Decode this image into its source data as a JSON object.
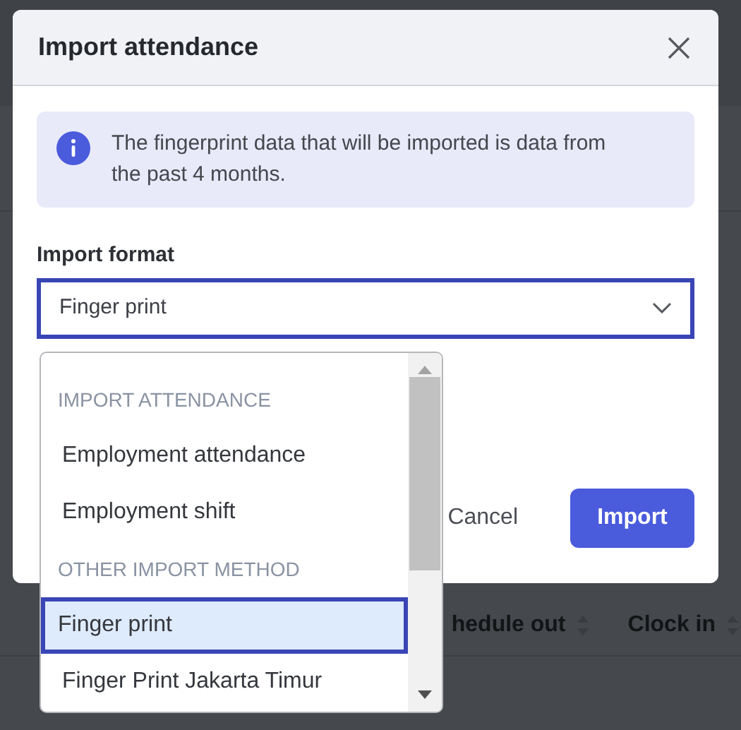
{
  "background": {
    "table_columns": [
      {
        "label": "hedule out"
      },
      {
        "label": "Clock in"
      }
    ]
  },
  "dialog": {
    "title": "Import attendance",
    "alert": "The fingerprint data that will be imported is data from the past 4 months.",
    "field_label": "Import format",
    "select": {
      "value": "Finger print",
      "expanded": true
    },
    "buttons": [
      {
        "label": "Cancel",
        "kind": "secondary"
      },
      {
        "label": "Import",
        "kind": "primary"
      }
    ]
  },
  "dropdown": {
    "items": [
      {
        "kind": "group",
        "label": "IMPORT ATTENDANCE"
      },
      {
        "kind": "option",
        "label": "Employment attendance",
        "selected": false
      },
      {
        "kind": "option",
        "label": "Employment shift",
        "selected": false
      },
      {
        "kind": "group",
        "label": "OTHER IMPORT METHOD"
      },
      {
        "kind": "option",
        "label": "Finger print",
        "selected": true
      },
      {
        "kind": "option",
        "label": "Finger Print Jakarta Timur",
        "selected": false
      }
    ]
  }
}
